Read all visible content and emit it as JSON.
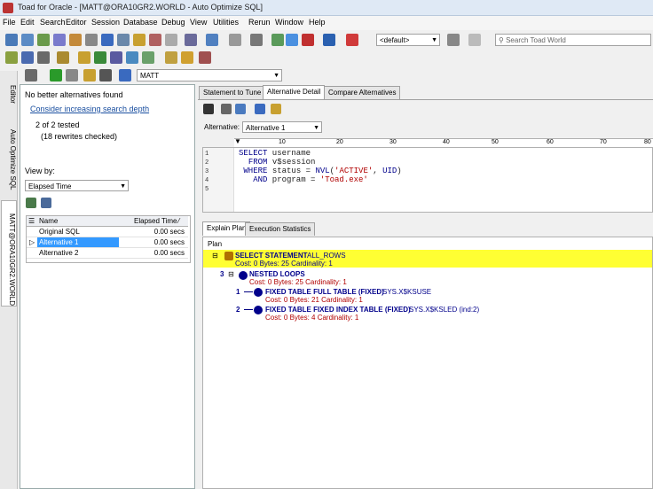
{
  "window": {
    "title": "Toad for Oracle - [MATT@ORA10GR2.WORLD - Auto Optimize SQL]"
  },
  "menu": [
    "File",
    "Edit",
    "Search",
    "Editor",
    "Session",
    "Database",
    "Debug",
    "View",
    "Utilities",
    "Rerun",
    "Window",
    "Help"
  ],
  "toolbar": {
    "default_combo": "<default>",
    "search_placeholder": "Search Toad World"
  },
  "connection_combo": "MATT",
  "side_tabs": [
    "Editor",
    "Auto Optimize SQL",
    "MATT@ORA10GR2.WORLD"
  ],
  "left": {
    "status": "No better alternatives found",
    "link": "Consider increasing search depth",
    "tested": "2 of 2 tested",
    "rewrites": "(18 rewrites checked)",
    "viewby_label": "View by:",
    "viewby_value": "Elapsed Time",
    "grid": {
      "headers": [
        "Name",
        "Elapsed Time"
      ],
      "rows": [
        {
          "name": "Original SQL",
          "time": "0.00 secs"
        },
        {
          "name": "Alternative 1",
          "time": "0.00 secs"
        },
        {
          "name": "Alternative 2",
          "time": "0.00 secs"
        }
      ]
    }
  },
  "right": {
    "tabs": [
      "Statement to Tune",
      "Alternative Detail",
      "Compare Alternatives"
    ],
    "alt_label": "Alternative:",
    "alt_value": "Alternative 1",
    "ruler": [
      "10",
      "20",
      "30",
      "40",
      "50",
      "60",
      "70",
      "80"
    ],
    "code_lines": [
      "1",
      "2",
      "3",
      "4",
      "5"
    ],
    "bottom_tabs": [
      "Explain Plan",
      "Execution Statistics"
    ],
    "plan_header": "Plan",
    "plan": {
      "root_title": "SELECT STATEMENT",
      "root_mode": "ALL_ROWS",
      "root_cost": "Cost: 0  Bytes: 25  Cardinality: 1",
      "n3_num": "3",
      "n3_title": "NESTED LOOPS",
      "n3_cost": "Cost: 0  Bytes: 25  Cardinality: 1",
      "n1_num": "1",
      "n1_title": "FIXED TABLE FULL TABLE (FIXED)",
      "n1_obj": "SYS.X$KSUSE",
      "n1_cost": "Cost: 0  Bytes: 21  Cardinality: 1",
      "n2_num": "2",
      "n2_title": "FIXED TABLE FIXED INDEX TABLE (FIXED)",
      "n2_obj": "SYS.X$KSLED (ind:2)",
      "n2_cost": "Cost: 0  Bytes: 4  Cardinality: 1"
    }
  }
}
